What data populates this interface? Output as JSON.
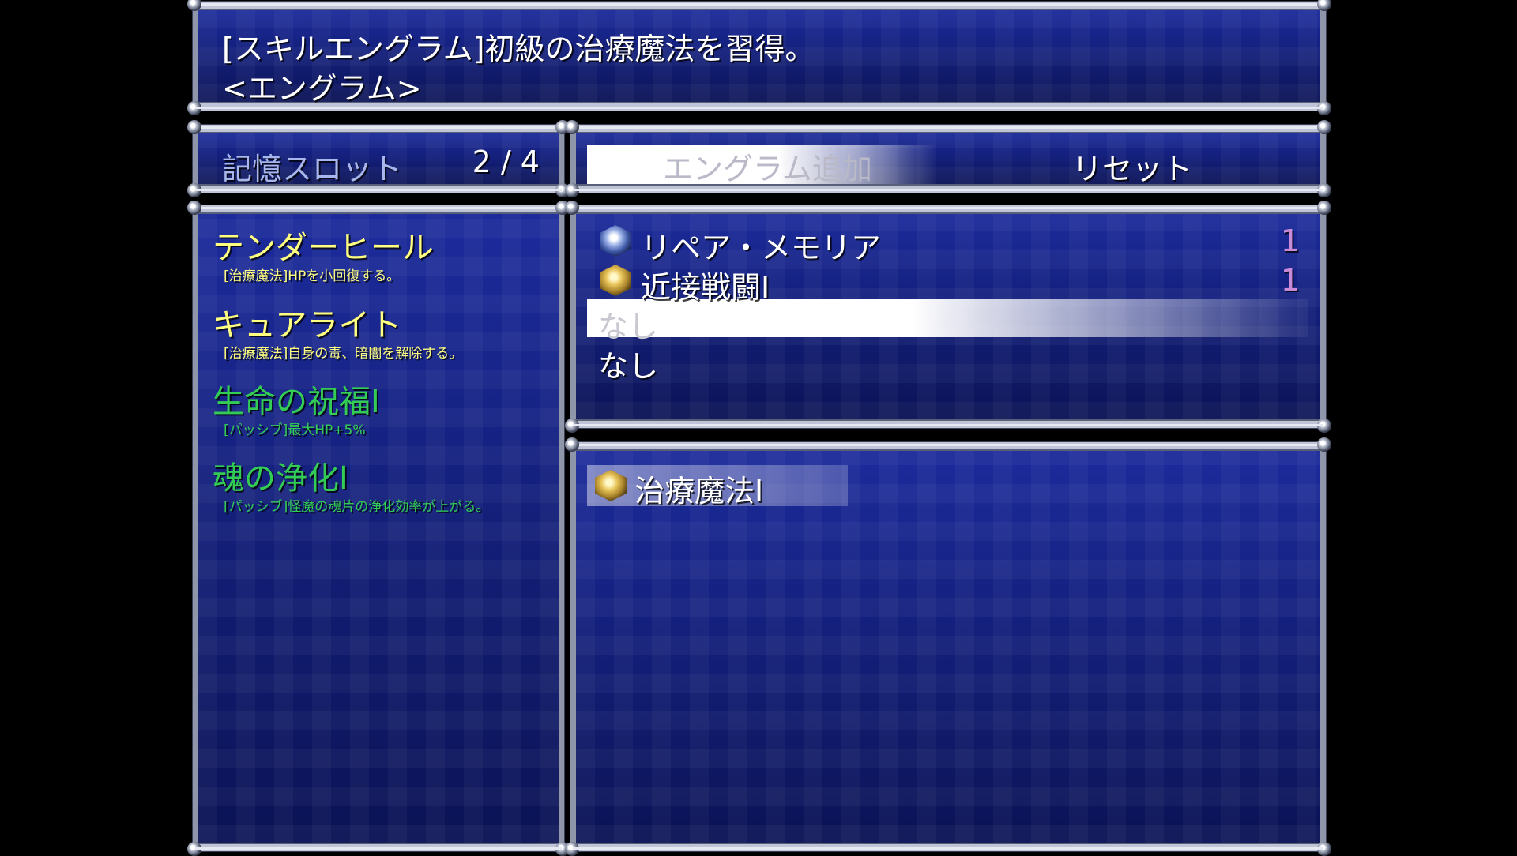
{
  "help": {
    "line1": "[スキルエングラム]初級の治療魔法を習得。",
    "line2": "<エングラム>"
  },
  "memory_slot": {
    "label": "記憶スロット",
    "value": "2 / 4"
  },
  "commands": {
    "add": "エングラム追加",
    "reset": "リセット"
  },
  "skills": [
    {
      "name": "テンダーヒール",
      "desc": "[治療魔法]HPを小回復する。",
      "color": "#ffff80"
    },
    {
      "name": "キュアライト",
      "desc": "[治療魔法]自身の毒、暗闇を解除する。",
      "color": "#ffff80"
    },
    {
      "name": "生命の祝福Ⅰ",
      "desc": "[パッシブ]最大HP+5%",
      "color": "#33cc55"
    },
    {
      "name": "魂の浄化Ⅰ",
      "desc": "[パッシブ]怪魔の魂片の浄化効率が上がる。",
      "color": "#33cc55"
    }
  ],
  "slots": [
    {
      "name": "リペア・メモリア",
      "count": "1",
      "icon": "blue-crystal-icon"
    },
    {
      "name": "近接戦闘Ⅰ",
      "count": "1",
      "icon": "gold-crystal-icon"
    },
    {
      "name": "なし"
    },
    {
      "name": "なし"
    }
  ],
  "engram_list": [
    {
      "name": "治療魔法Ⅰ",
      "icon": "gold-crystal-icon"
    }
  ],
  "colors": {
    "window_blue": "#14207c",
    "frame_silver": "#bfc5d6",
    "system_label": "#a7b6ec",
    "skill_yellow": "#ffff80",
    "passive_green": "#33cc55",
    "count_purple": "#c98ad8"
  }
}
